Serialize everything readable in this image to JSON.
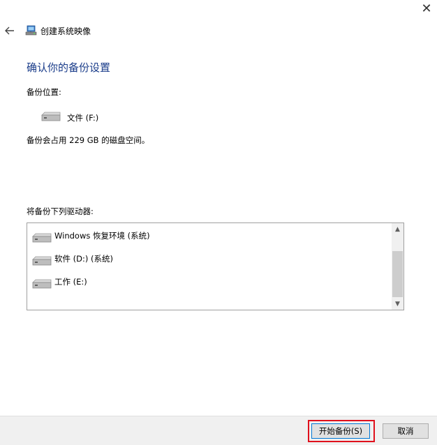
{
  "window": {
    "title": "创建系统映像",
    "close_label": "✕"
  },
  "page": {
    "heading": "确认你的备份设置",
    "backup_location_label": "备份位置:",
    "backup_location_drive": "文件 (F:)",
    "space_info": "备份会占用 229 GB 的磁盘空间。",
    "drives_to_backup_label": "将备份下列驱动器:"
  },
  "drives": [
    {
      "label": "Windows 恢复环境 (系统)"
    },
    {
      "label": "软件 (D:) (系统)"
    },
    {
      "label": "工作 (E:)"
    }
  ],
  "scrollbar": {
    "up_arrow": "▲",
    "down_arrow": "▼"
  },
  "footer": {
    "start_backup_label": "开始备份(S)",
    "cancel_label": "取消"
  },
  "icons": {
    "back": "back-arrow-icon",
    "app": "system-image-icon",
    "drive": "hard-drive-icon",
    "close": "close-icon"
  },
  "colors": {
    "heading": "#1a3c8a",
    "highlight": "#e0101c",
    "primary_border": "#0078d7"
  }
}
